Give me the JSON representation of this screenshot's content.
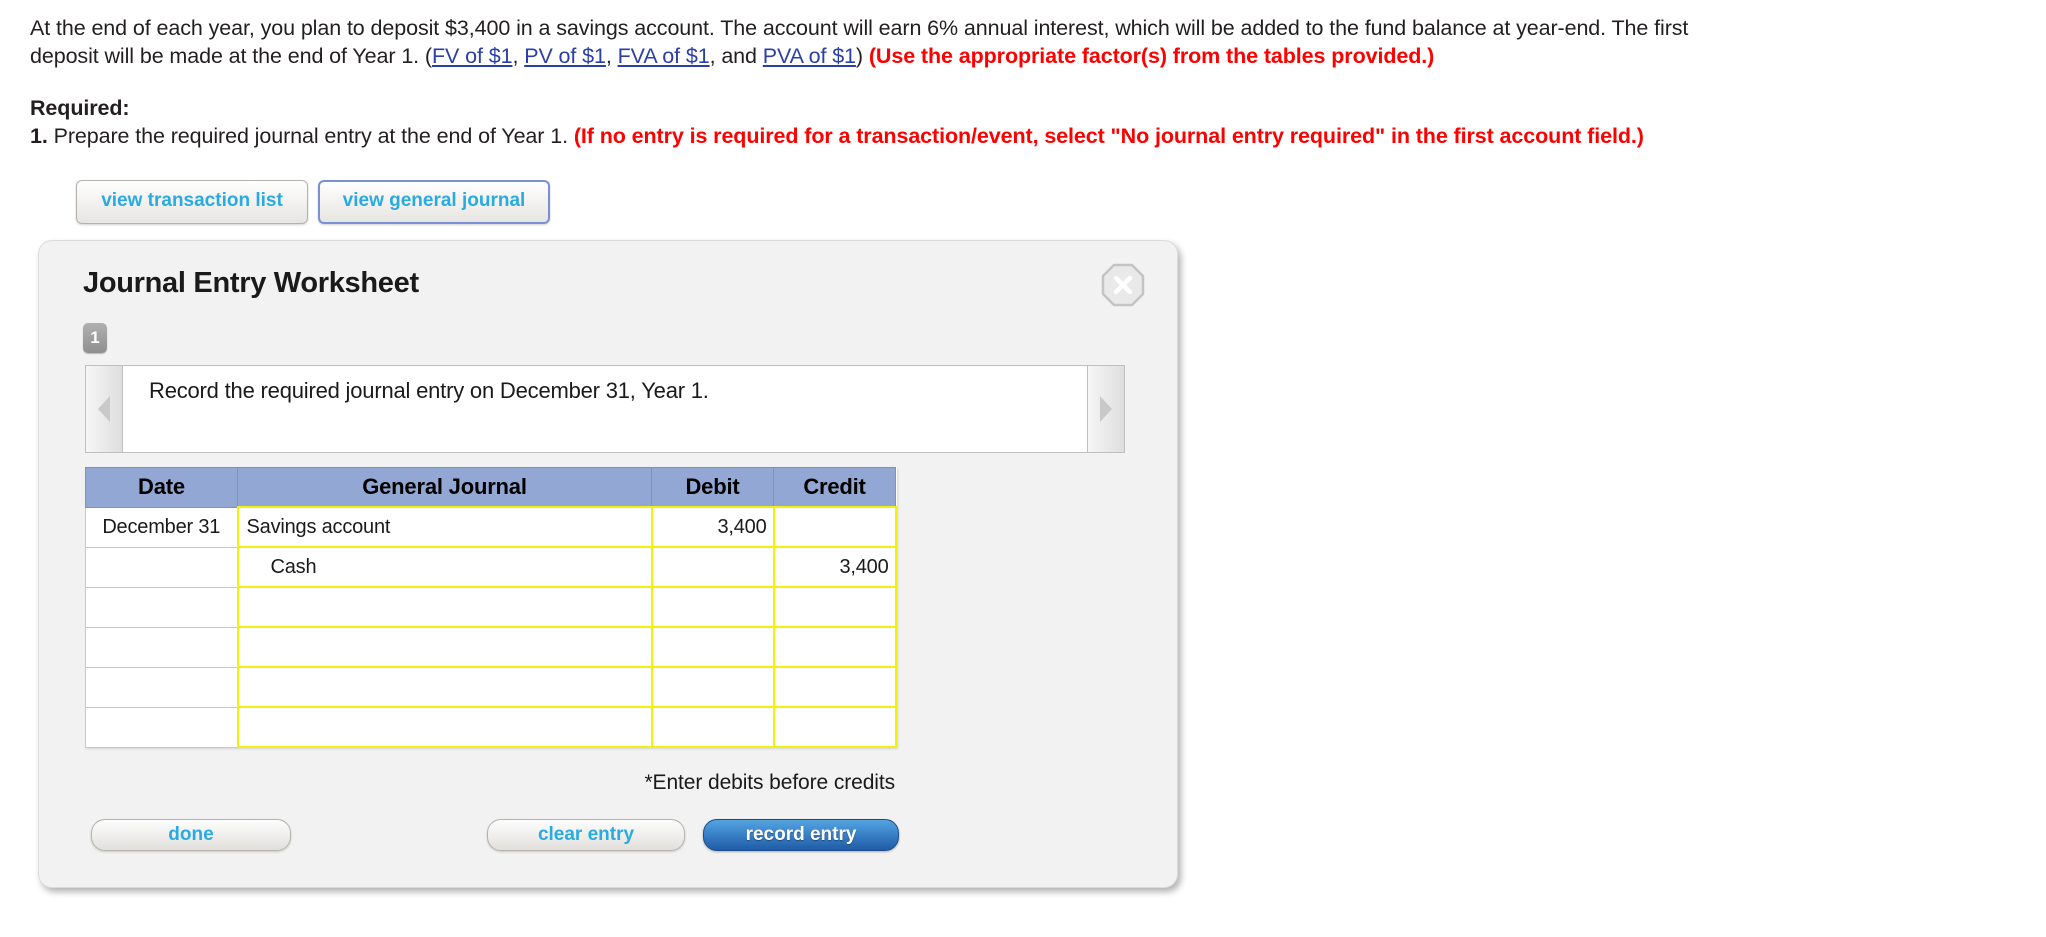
{
  "problem": {
    "line1_part1": "At the end of each year, you plan to deposit $3,400 in a savings account. The account will earn 6% annual interest, which will be added to the fund balance at year-end. The first",
    "line2_part1": "deposit will be made at the end of Year 1. (",
    "link_fv": "FV of $1",
    "sep1": ", ",
    "link_pv": "PV of $1",
    "sep2": ", ",
    "link_fva": "FVA of $1",
    "sep3": ", and ",
    "link_pva": "PVA of $1",
    "close_paren": ") ",
    "use_factors_note": "(Use the appropriate factor(s) from the tables provided.)"
  },
  "required": {
    "label": "Required:",
    "item_number": "1.",
    "item_text": " Prepare the required journal entry at the end of Year 1. ",
    "item_note": "(If no entry is required for a transaction/event, select \"No journal entry required\" in the first account field.)"
  },
  "tabs": [
    {
      "label": "view transaction list",
      "selected": false
    },
    {
      "label": "view general journal",
      "selected": true
    }
  ],
  "worksheet": {
    "title": "Journal Entry Worksheet",
    "close_icon": "close-x-icon",
    "step_badge": "1",
    "prev_icon": "chevron-left-icon",
    "next_icon": "chevron-right-icon",
    "instruction": "Record the required journal entry on December 31, Year 1.",
    "table": {
      "headers": [
        "Date",
        "General Journal",
        "Debit",
        "Credit"
      ],
      "rows": [
        {
          "date": "December 31",
          "account": "Savings account",
          "indent": false,
          "debit": "3,400",
          "credit": ""
        },
        {
          "date": "",
          "account": "Cash",
          "indent": true,
          "debit": "",
          "credit": "3,400"
        },
        {
          "date": "",
          "account": "",
          "indent": false,
          "debit": "",
          "credit": ""
        },
        {
          "date": "",
          "account": "",
          "indent": false,
          "debit": "",
          "credit": ""
        },
        {
          "date": "",
          "account": "",
          "indent": false,
          "debit": "",
          "credit": ""
        },
        {
          "date": "",
          "account": "",
          "indent": false,
          "debit": "",
          "credit": ""
        }
      ]
    },
    "note": "*Enter debits before credits",
    "buttons": {
      "done": "done",
      "clear_entry": "clear entry",
      "record_entry": "record entry"
    }
  },
  "colors": {
    "link": "#2c3ea8",
    "alert_red": "#ff0000",
    "tab_text": "#29abe2",
    "table_header_bg": "#93a7d4",
    "input_cell_border": "#f2f10d",
    "record_button": "#3d86cc",
    "selected_tab_border": "#7b8fd4"
  }
}
